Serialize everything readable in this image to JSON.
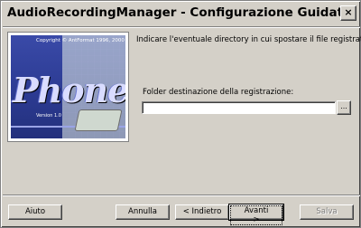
{
  "window": {
    "title": "AudioRecordingManager - Configurazione Guidata",
    "close_label": "×"
  },
  "image": {
    "copyright": "Copyright © AntFormat 1996, 2000",
    "brand": "Phones",
    "version": "Version 1.0"
  },
  "main": {
    "instruction": "Indicare l'eventuale directory in cui spostare il file registrato.",
    "field_label": "Folder destinazione della registrazione:",
    "field_value": "",
    "browse_label": "..."
  },
  "buttons": {
    "help": "Aiuto",
    "cancel": "Annulla",
    "back": "< Indietro",
    "next": "Avanti >",
    "save": "Salva"
  }
}
